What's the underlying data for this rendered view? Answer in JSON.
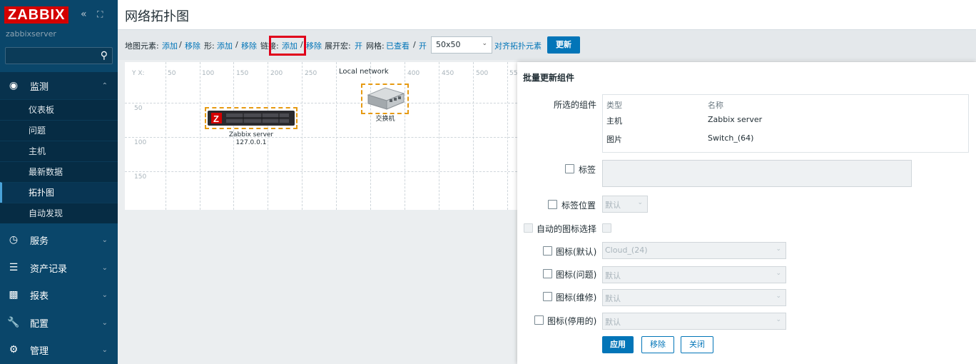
{
  "sidebar": {
    "logo": "ZABBIX",
    "collapse_icon": "«",
    "kiosk_icon": "⛶",
    "server_name": "zabbixserver",
    "search_placeholder": "",
    "sections": [
      {
        "label": "监测",
        "icon": "eye-icon"
      },
      {
        "label": "服务",
        "icon": "clock-icon"
      },
      {
        "label": "资产记录",
        "icon": "list-icon"
      },
      {
        "label": "报表",
        "icon": "bar-chart-icon"
      },
      {
        "label": "配置",
        "icon": "wrench-icon"
      },
      {
        "label": "管理",
        "icon": "gear-icon"
      }
    ],
    "monitoring_items": [
      "仪表板",
      "问题",
      "主机",
      "最新数据",
      "拓扑图",
      "自动发现"
    ]
  },
  "header": {
    "title": "网络拓扑图"
  },
  "toolbar": {
    "map_elements_label": "地图元素:",
    "add": "添加",
    "sep": "/",
    "remove": "移除",
    "shapes_label": "形:",
    "links_label": "链接:",
    "expand_macros_label": "展开宏:",
    "on": "开",
    "grid_label": "网格:",
    "shown": "已查看",
    "grid_size": "50x50",
    "align_label": "对齐拓扑元素",
    "update_button": "更新"
  },
  "map": {
    "corner_label": "Y X:",
    "x_ticks": [
      "50",
      "100",
      "150",
      "200",
      "250",
      "300",
      "350",
      "400",
      "450",
      "500",
      "55"
    ],
    "y_ticks": [
      "50",
      "100",
      "150"
    ],
    "elements": [
      {
        "name": "server",
        "label_line1": "Zabbix server",
        "label_line2": "127.0.0.1"
      },
      {
        "name": "switch",
        "label_line1": "交换机"
      }
    ],
    "network_label": "Local network"
  },
  "dialog": {
    "title": "批量更新组件",
    "selected_label": "所选的组件",
    "col_type": "类型",
    "col_name": "名称",
    "rows": [
      {
        "type": "主机",
        "name": "Zabbix server"
      },
      {
        "type": "图片",
        "name": "Switch_(64)"
      }
    ],
    "label_label": "标签",
    "label_pos_label": "标签位置",
    "label_pos_value": "默认",
    "auto_icon_label": "自动的图标选择",
    "icon_default_label": "图标(默认)",
    "icon_default_value": "Cloud_(24)",
    "icon_problem_label": "图标(问题)",
    "icon_maint_label": "图标(维修)",
    "icon_disabled_label": "图标(停用的)",
    "default_value": "默认",
    "apply": "应用",
    "remove": "移除",
    "close": "关闭"
  },
  "colors": {
    "sidebar": "#0a466a",
    "accent": "#0275b8",
    "logo": "#d40000",
    "highlight": "#e0001b"
  }
}
